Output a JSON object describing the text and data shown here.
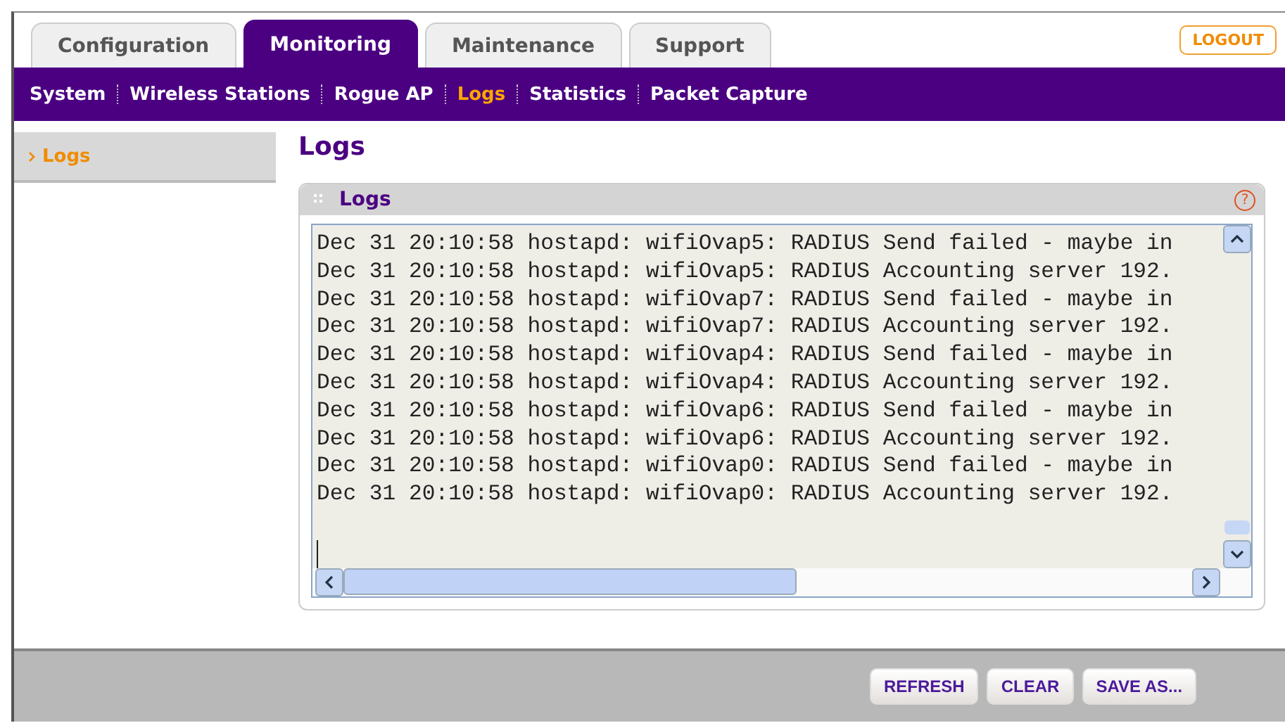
{
  "tabs": [
    {
      "label": "Configuration",
      "selected": false
    },
    {
      "label": "Monitoring",
      "selected": true
    },
    {
      "label": "Maintenance",
      "selected": false
    },
    {
      "label": "Support",
      "selected": false
    }
  ],
  "logout": "LOGOUT",
  "subnav": [
    {
      "label": "System",
      "selected": false
    },
    {
      "label": "Wireless Stations",
      "selected": false
    },
    {
      "label": "Rogue AP",
      "selected": false
    },
    {
      "label": "Logs",
      "selected": true
    },
    {
      "label": "Statistics",
      "selected": false
    },
    {
      "label": "Packet Capture",
      "selected": false
    }
  ],
  "sidebar": {
    "items": [
      {
        "label": "Logs",
        "selected": true
      }
    ]
  },
  "page_title": "Logs",
  "panel": {
    "title": "Logs",
    "help": "?",
    "log_lines": [
      "Dec 31 20:10:58 hostapd: wifiOvap5: RADIUS Send failed - maybe in",
      "Dec 31 20:10:58 hostapd: wifiOvap5: RADIUS Accounting server 192.",
      "Dec 31 20:10:58 hostapd: wifiOvap7: RADIUS Send failed - maybe in",
      "Dec 31 20:10:58 hostapd: wifiOvap7: RADIUS Accounting server 192.",
      "Dec 31 20:10:58 hostapd: wifiOvap4: RADIUS Send failed - maybe in",
      "Dec 31 20:10:58 hostapd: wifiOvap4: RADIUS Accounting server 192.",
      "Dec 31 20:10:58 hostapd: wifiOvap6: RADIUS Send failed - maybe in",
      "Dec 31 20:10:58 hostapd: wifiOvap6: RADIUS Accounting server 192.",
      "Dec 31 20:10:58 hostapd: wifiOvap0: RADIUS Send failed - maybe in",
      "Dec 31 20:10:58 hostapd: wifiOvap0: RADIUS Accounting server 192."
    ]
  },
  "buttons": [
    "REFRESH",
    "CLEAR",
    "SAVE AS..."
  ]
}
